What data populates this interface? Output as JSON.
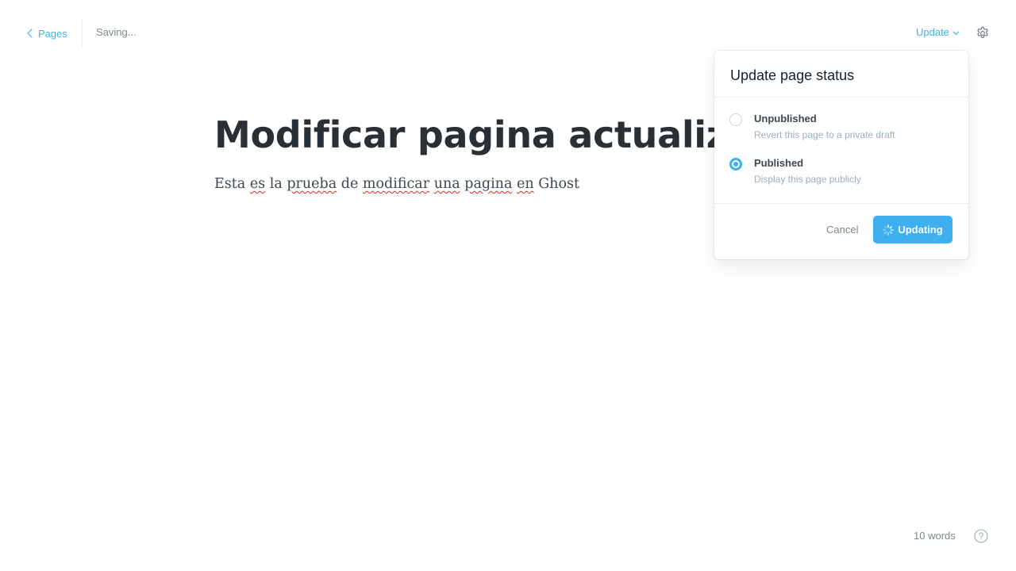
{
  "header": {
    "back_label": "Pages",
    "save_status": "Saving...",
    "update_label": "Update"
  },
  "editor": {
    "title": "Modificar pagina actualizado",
    "body_words": [
      "Esta",
      "es",
      "la",
      "prueba",
      "de",
      "modificar",
      "una",
      "pagina",
      "en",
      "Ghost"
    ]
  },
  "popover": {
    "title": "Update page status",
    "options": [
      {
        "label": "Unpublished",
        "description": "Revert this page to a private draft",
        "selected": false
      },
      {
        "label": "Published",
        "description": "Display this page publicly",
        "selected": true
      }
    ],
    "cancel_label": "Cancel",
    "confirm_label": "Updating"
  },
  "footer": {
    "word_count": "10 words"
  },
  "icons": {
    "back": "chevron-left-icon",
    "dropdown": "chevron-down-icon",
    "settings": "gear-icon",
    "spinner": "spinner-icon",
    "help": "question-circle-icon"
  },
  "colors": {
    "accent": "#3eb0ef",
    "muted": "#7d878a",
    "title": "#2a2f34",
    "spellcheck": "#e2241b"
  }
}
